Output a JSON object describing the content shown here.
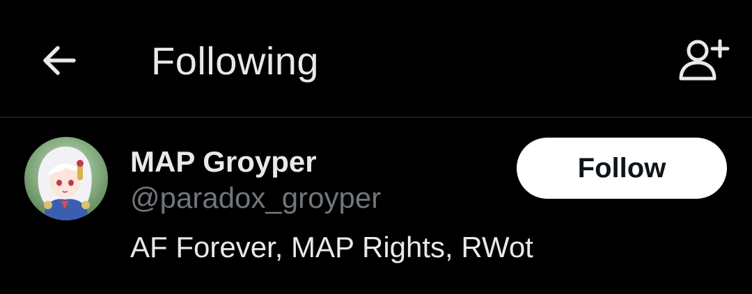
{
  "header": {
    "back_icon": "arrow-left-icon",
    "title": "Following",
    "add_user_icon": "person-add-icon"
  },
  "user": {
    "display_name": "MAP Groyper",
    "handle": "@paradox_groyper",
    "bio": "AF Forever, MAP Rights, RWot",
    "follow_label": "Follow",
    "avatar_icon": "profile-avatar"
  },
  "colors": {
    "background": "#000000",
    "primary_text": "#e7e9ea",
    "secondary_text": "#71767b",
    "divider": "#2f3336",
    "button_bg": "#ffffff",
    "button_text": "#0f1419"
  }
}
